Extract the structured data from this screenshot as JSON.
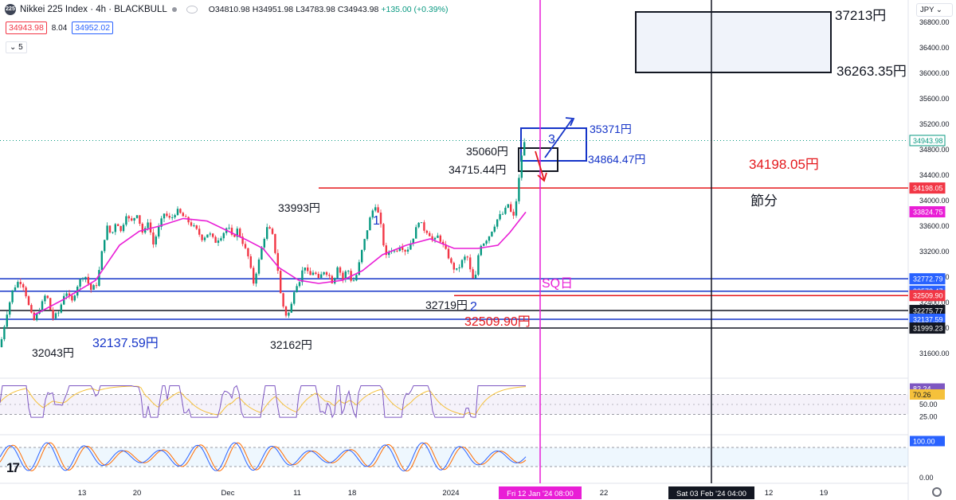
{
  "header": {
    "symbol": "Nikkei 225 Index · 4h · BLACKBULL",
    "logo_text": "225",
    "ohlc_o": "O34810.98",
    "ohlc_h": "H34951.98",
    "ohlc_l": "L34783.98",
    "ohlc_c": "C34943.98",
    "change": "+135.00 (+0.39%)",
    "bid": "34943.98",
    "spread": "8.04",
    "ask": "34952.02",
    "collapse": "5",
    "currency": "JPY"
  },
  "colors": {
    "up": "#089981",
    "down": "#f23645",
    "ma": "#e91ed6",
    "blue": "#1534c8",
    "red": "#e4181c",
    "rsi": "#7e57c2",
    "rsi_ma": "#f5c13b",
    "stoch_k": "#2962ff",
    "stoch_d": "#ff6d00"
  },
  "chart_data": {
    "type": "candlestick",
    "interval": "4h",
    "y_axis": {
      "ylim": [
        31500,
        37400
      ],
      "ticks": [
        "31600.00",
        "32000.00",
        "32400.00",
        "32800.00",
        "33200.00",
        "33600.00",
        "34000.00",
        "34400.00",
        "34800.00",
        "35200.00",
        "35600.00",
        "36000.00",
        "36400.00",
        "36800.00"
      ]
    },
    "x_axis": {
      "ticks": [
        "13",
        "20",
        "Dec",
        "11",
        "18",
        "2024",
        "22",
        "12",
        "19"
      ],
      "cursor_labels": [
        "Fri 12 Jan '24   08:00",
        "Sat 03 Feb '24   04:00"
      ]
    },
    "price_path": [
      [
        0,
        31700
      ],
      [
        8,
        32200
      ],
      [
        16,
        32600
      ],
      [
        24,
        32750
      ],
      [
        30,
        32650
      ],
      [
        36,
        32350
      ],
      [
        42,
        32100
      ],
      [
        50,
        32300
      ],
      [
        58,
        32550
      ],
      [
        66,
        32150
      ],
      [
        74,
        32250
      ],
      [
        82,
        32600
      ],
      [
        90,
        32400
      ],
      [
        98,
        32700
      ],
      [
        106,
        32850
      ],
      [
        114,
        32600
      ],
      [
        122,
        32700
      ],
      [
        128,
        33200
      ],
      [
        134,
        33600
      ],
      [
        140,
        33450
      ],
      [
        146,
        33700
      ],
      [
        152,
        33500
      ],
      [
        158,
        33800
      ],
      [
        164,
        33650
      ],
      [
        172,
        33800
      ],
      [
        180,
        33450
      ],
      [
        186,
        33700
      ],
      [
        192,
        33300
      ],
      [
        200,
        33600
      ],
      [
        206,
        33800
      ],
      [
        214,
        33700
      ],
      [
        222,
        33850
      ],
      [
        230,
        33750
      ],
      [
        238,
        33650
      ],
      [
        246,
        33550
      ],
      [
        254,
        33400
      ],
      [
        262,
        33500
      ],
      [
        270,
        33350
      ],
      [
        278,
        33450
      ],
      [
        286,
        33600
      ],
      [
        292,
        33400
      ],
      [
        298,
        33550
      ],
      [
        306,
        33300
      ],
      [
        312,
        33100
      ],
      [
        318,
        32700
      ],
      [
        324,
        33000
      ],
      [
        330,
        33350
      ],
      [
        336,
        33600
      ],
      [
        342,
        33450
      ],
      [
        348,
        33000
      ],
      [
        352,
        32550
      ],
      [
        358,
        32200
      ],
      [
        364,
        32250
      ],
      [
        370,
        32650
      ],
      [
        376,
        32750
      ],
      [
        382,
        33000
      ],
      [
        388,
        32800
      ],
      [
        394,
        32900
      ],
      [
        400,
        32750
      ],
      [
        406,
        32900
      ],
      [
        412,
        32850
      ],
      [
        418,
        32700
      ],
      [
        424,
        33000
      ],
      [
        430,
        32750
      ],
      [
        436,
        32950
      ],
      [
        442,
        32700
      ],
      [
        448,
        32850
      ],
      [
        454,
        33200
      ],
      [
        460,
        33500
      ],
      [
        466,
        33800
      ],
      [
        472,
        33950
      ],
      [
        478,
        33600
      ],
      [
        484,
        33100
      ],
      [
        490,
        33250
      ],
      [
        496,
        33200
      ],
      [
        502,
        33300
      ],
      [
        510,
        33200
      ],
      [
        518,
        33400
      ],
      [
        526,
        33700
      ],
      [
        532,
        33550
      ],
      [
        538,
        33500
      ],
      [
        544,
        33350
      ],
      [
        550,
        33450
      ],
      [
        556,
        33300
      ],
      [
        562,
        33150
      ],
      [
        568,
        32950
      ],
      [
        574,
        32900
      ],
      [
        580,
        33050
      ],
      [
        586,
        33150
      ],
      [
        592,
        32800
      ],
      [
        596,
        32720
      ],
      [
        602,
        33300
      ],
      [
        608,
        33350
      ],
      [
        614,
        33450
      ],
      [
        620,
        33600
      ],
      [
        626,
        33750
      ],
      [
        632,
        33800
      ],
      [
        638,
        33950
      ],
      [
        644,
        33700
      ],
      [
        648,
        34000
      ],
      [
        652,
        34400
      ],
      [
        656,
        34850
      ],
      [
        660,
        34950
      ]
    ],
    "ma_path": [
      [
        42,
        32200
      ],
      [
        80,
        32450
      ],
      [
        120,
        32750
      ],
      [
        150,
        33300
      ],
      [
        175,
        33520
      ],
      [
        200,
        33600
      ],
      [
        230,
        33720
      ],
      [
        260,
        33680
      ],
      [
        290,
        33500
      ],
      [
        310,
        33380
      ],
      [
        330,
        33250
      ],
      [
        350,
        32950
      ],
      [
        375,
        32750
      ],
      [
        400,
        32700
      ],
      [
        430,
        32750
      ],
      [
        455,
        32900
      ],
      [
        480,
        33150
      ],
      [
        510,
        33300
      ],
      [
        540,
        33400
      ],
      [
        570,
        33250
      ],
      [
        600,
        33250
      ],
      [
        625,
        33300
      ],
      [
        640,
        33500
      ],
      [
        660,
        33820
      ]
    ],
    "price_lines": [
      {
        "value": "34198.05",
        "color": "#e4181c",
        "from_x": 400
      },
      {
        "value": "32772.79",
        "color": "#1534c8",
        "from_x": 0
      },
      {
        "value": "32578.47",
        "color": "#1534c8",
        "from_x": 0
      },
      {
        "value": "32509.90",
        "color": "#e4181c",
        "from_x": 570
      },
      {
        "value": "32275.77",
        "color": "#131722",
        "from_x": 0
      },
      {
        "value": "32137.59",
        "color": "#1534c8",
        "from_x": 0
      },
      {
        "value": "31999.23",
        "color": "#131722",
        "from_x": 0
      }
    ],
    "axis_tags": [
      {
        "value": "34943.98",
        "bg": "#ffffff",
        "fg": "#089981",
        "border": "#089981"
      },
      {
        "value": "34198.05",
        "bg": "#f23645",
        "fg": "#ffffff"
      },
      {
        "value": "33824.75",
        "bg": "#e91ed6",
        "fg": "#ffffff"
      },
      {
        "value": "32772.79",
        "bg": "#2962ff",
        "fg": "#ffffff"
      },
      {
        "value": "32578.47",
        "bg": "#2962ff",
        "fg": "#ffffff"
      },
      {
        "value": "32509.90",
        "bg": "#f23645",
        "fg": "#ffffff"
      },
      {
        "value": "32275.77",
        "bg": "#131722",
        "fg": "#ffffff"
      },
      {
        "value": "32137.59",
        "bg": "#2962ff",
        "fg": "#ffffff"
      },
      {
        "value": "31999.23",
        "bg": "#131722",
        "fg": "#ffffff"
      }
    ],
    "annotations": [
      {
        "text": "37213円",
        "color": "#131722",
        "size": 17
      },
      {
        "text": "36263.35円",
        "color": "#131722",
        "size": 17
      },
      {
        "text": "35371円",
        "color": "#1534c8",
        "size": 14
      },
      {
        "text": "34864.47円",
        "color": "#1534c8",
        "size": 14
      },
      {
        "text": "35060円",
        "color": "#131722",
        "size": 14
      },
      {
        "text": "34715.44円",
        "color": "#131722",
        "size": 14
      },
      {
        "text": "34198.05円",
        "color": "#e4181c",
        "size": 17
      },
      {
        "text": "節分",
        "color": "#131722",
        "size": 17
      },
      {
        "text": "33993円",
        "color": "#131722",
        "size": 14
      },
      {
        "text": "SQ日",
        "color": "#e91ed6",
        "size": 16
      },
      {
        "text": "32719円",
        "color": "#131722",
        "size": 14
      },
      {
        "text": "32509.90円",
        "color": "#e4181c",
        "size": 16
      },
      {
        "text": "32137.59円",
        "color": "#1534c8",
        "size": 16
      },
      {
        "text": "32162円",
        "color": "#131722",
        "size": 14
      },
      {
        "text": "32043円",
        "color": "#131722",
        "size": 14
      },
      {
        "text": "1",
        "color": "#1534c8",
        "size": 16
      },
      {
        "text": "2",
        "color": "#1534c8",
        "size": 16
      },
      {
        "text": "3",
        "color": "#1534c8",
        "size": 16
      }
    ],
    "rsi": {
      "ylim": [
        0,
        100
      ],
      "ticks": [
        "50.00",
        "25.00"
      ],
      "levels": [
        70,
        30
      ],
      "value": "82.24",
      "ma_value": "70.26"
    },
    "stochastic": {
      "ylim": [
        0,
        100
      ],
      "ticks": [
        "100.00",
        "0.00"
      ],
      "levels": [
        80,
        20
      ]
    }
  }
}
